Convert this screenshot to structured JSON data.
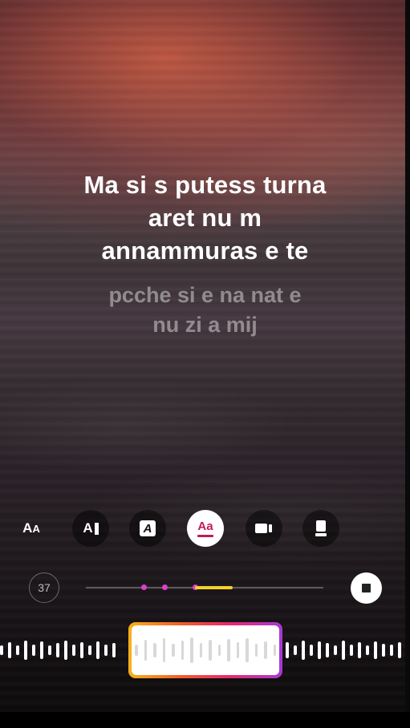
{
  "lyrics": {
    "current_lines": [
      "Ma si s putess turna",
      "aret nu m",
      "annammuras e te"
    ],
    "next_lines": [
      "pcche si e na nat e",
      "nu zi a mij"
    ]
  },
  "style_options": [
    {
      "name": "text-size-icon",
      "glyph": "Aa",
      "selected": false
    },
    {
      "name": "text-cursor-icon",
      "glyph": "AI",
      "selected": false
    },
    {
      "name": "text-box-icon",
      "glyph": "A",
      "selected": false
    },
    {
      "name": "text-underline-icon",
      "glyph": "Aa",
      "selected": true
    },
    {
      "name": "video-camera-icon",
      "glyph": "",
      "selected": false
    },
    {
      "name": "card-icon",
      "glyph": "",
      "selected": false
    }
  ],
  "player": {
    "timer_seconds": "37",
    "position_fraction": 0.46,
    "accent_color": "#f2d12b",
    "marker_color": "#e23dd0"
  },
  "selection_gradient": [
    "#f7b21a",
    "#f25b2b",
    "#e8286d",
    "#a53ad6"
  ]
}
